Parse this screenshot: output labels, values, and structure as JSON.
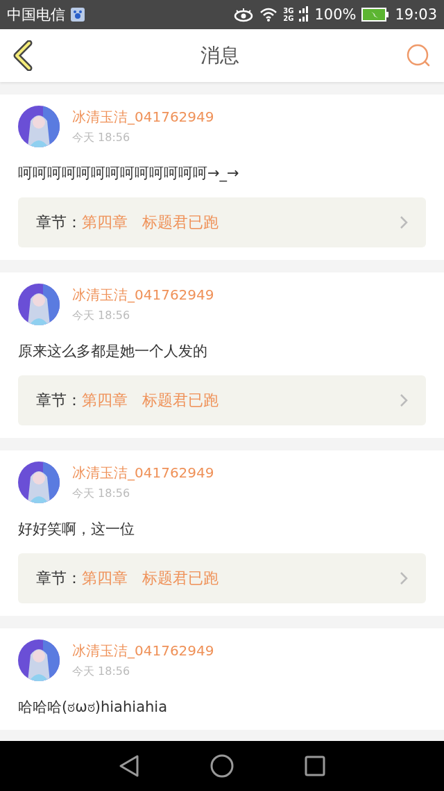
{
  "status_bar": {
    "carrier": "中国电信",
    "network_top": "3G",
    "network_bottom": "2G",
    "battery": "100%",
    "time": "19:03"
  },
  "header": {
    "title": "消息"
  },
  "messages": [
    {
      "user": "冰清玉洁_041762949",
      "time": "今天 18:56",
      "text": "呵呵呵呵呵呵呵呵呵呵呵呵呵→_→",
      "chapter": {
        "label": "章节：",
        "value": "第四章   标题君已跑"
      }
    },
    {
      "user": "冰清玉洁_041762949",
      "time": "今天 18:56",
      "text": "原来这么多都是她一个人发的",
      "chapter": {
        "label": "章节：",
        "value": "第四章   标题君已跑"
      }
    },
    {
      "user": "冰清玉洁_041762949",
      "time": "今天 18:56",
      "text": "好好笑啊，这一位",
      "chapter": {
        "label": "章节：",
        "value": "第四章   标题君已跑"
      }
    },
    {
      "user": "冰清玉洁_041762949",
      "time": "今天 18:56",
      "text": "哈哈哈(ಠωಠ)hiahiahia"
    }
  ]
}
